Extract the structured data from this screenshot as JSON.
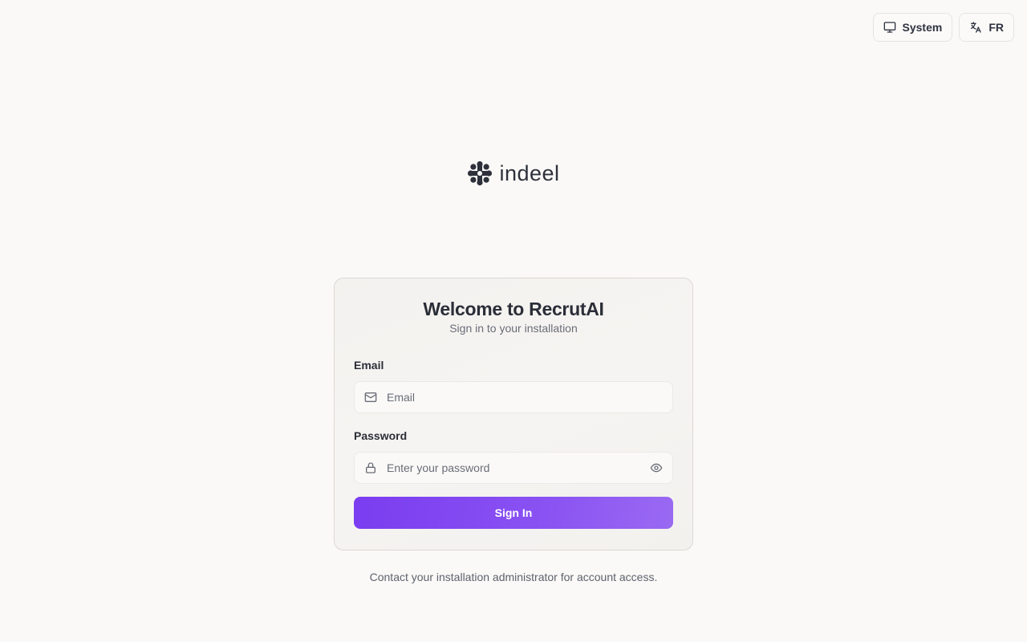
{
  "top_controls": {
    "theme_label": "System",
    "language_label": "FR"
  },
  "logo": {
    "text": "indeel",
    "icon": "asterisk-logo-icon"
  },
  "card": {
    "title": "Welcome to RecrutAI",
    "subtitle": "Sign in to your installation",
    "email": {
      "label": "Email",
      "placeholder": "Email",
      "value": "",
      "icon": "mail-icon"
    },
    "password": {
      "label": "Password",
      "placeholder": "Enter your password",
      "value": "",
      "icon": "lock-icon",
      "toggle_icon": "eye-icon"
    },
    "submit_label": "Sign In"
  },
  "footer": {
    "note": "Contact your installation administrator for account access."
  },
  "colors": {
    "background": "#faf9f7",
    "accent": "#7a3df0",
    "text": "#2b2e38",
    "muted": "#6a6d78"
  }
}
